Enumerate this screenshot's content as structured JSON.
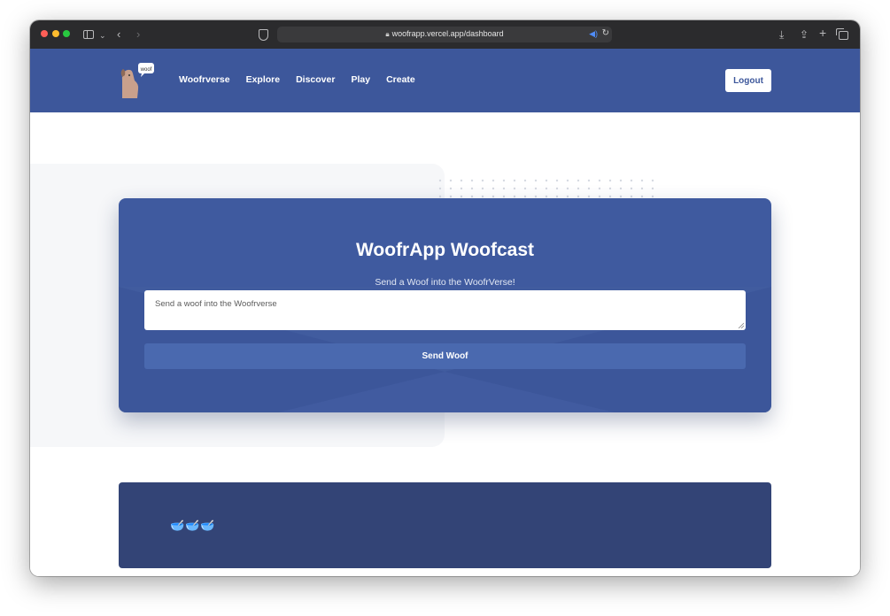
{
  "browser": {
    "url_text": "woofrapp.vercel.app/dashboard",
    "lock_icon": "lock-icon",
    "speaker_icon": "speaker-icon",
    "reload_icon": "reload-icon"
  },
  "nav": {
    "logo_badge": "woof",
    "links": [
      "Woofrverse",
      "Explore",
      "Discover",
      "Play",
      "Create"
    ],
    "logout_label": "Logout"
  },
  "woofcast": {
    "title": "WoofrApp Woofcast",
    "subtitle": "Send a Woof into the WoofrVerse!",
    "input_placeholder": "Send a woof into the Woofrverse",
    "input_value": "",
    "send_label": "Send Woof"
  },
  "feed": {
    "icons": "🥣🥣🥣"
  },
  "colors": {
    "brand_blue": "#3d579b",
    "card_blue": "#3f5a9f",
    "button_blue": "#4a69af",
    "feed_blue": "#334476"
  }
}
